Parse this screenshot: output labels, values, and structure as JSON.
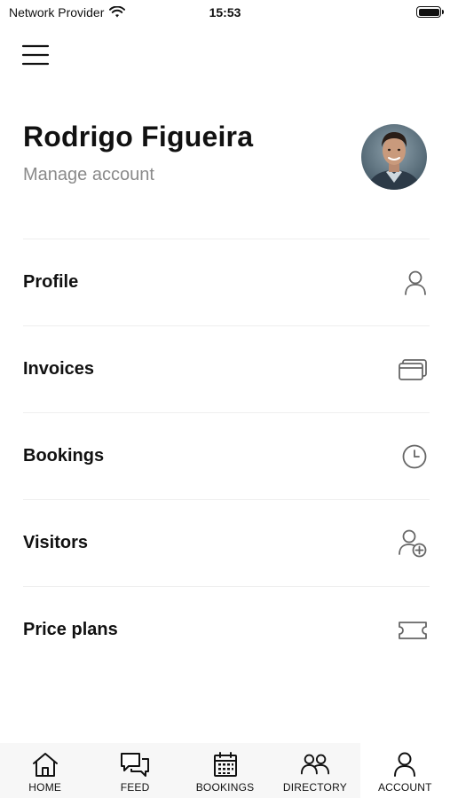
{
  "status_bar": {
    "carrier": "Network Provider",
    "time": "15:53"
  },
  "header": {
    "user_name": "Rodrigo Figueira",
    "manage_label": "Manage account"
  },
  "menu": {
    "items": [
      {
        "label": "Profile",
        "icon": "person-icon"
      },
      {
        "label": "Invoices",
        "icon": "cards-icon"
      },
      {
        "label": "Bookings",
        "icon": "clock-icon"
      },
      {
        "label": "Visitors",
        "icon": "add-person-icon"
      },
      {
        "label": "Price plans",
        "icon": "ticket-icon"
      }
    ]
  },
  "tab_bar": {
    "tabs": [
      {
        "label": "HOME",
        "icon": "home-icon"
      },
      {
        "label": "FEED",
        "icon": "chat-icon"
      },
      {
        "label": "BOOKINGS",
        "icon": "calendar-icon"
      },
      {
        "label": "DIRECTORY",
        "icon": "people-icon"
      },
      {
        "label": "ACCOUNT",
        "icon": "person-icon"
      }
    ],
    "active": "ACCOUNT"
  },
  "colors": {
    "text": "#111111",
    "muted": "#8a8a8a",
    "icon": "#666666",
    "divider": "#eeeeee",
    "tab_bar_bg": "#f7f7f7"
  }
}
